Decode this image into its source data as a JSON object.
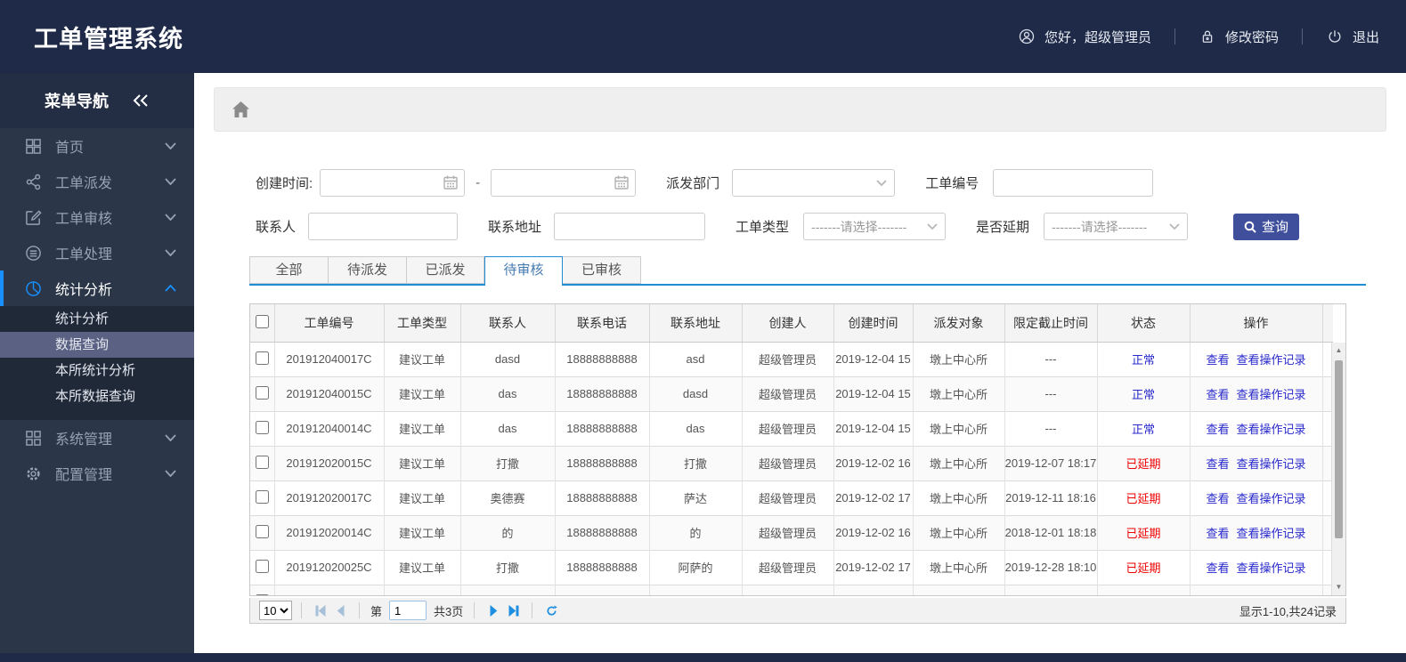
{
  "header": {
    "title": "工单管理系统",
    "greeting": "您好，超级管理员",
    "change_password": "修改密码",
    "logout": "退出"
  },
  "sidebar": {
    "title": "菜单导航",
    "items": [
      {
        "label": "首页",
        "icon": "grid-icon"
      },
      {
        "label": "工单派发",
        "icon": "share-icon"
      },
      {
        "label": "工单审核",
        "icon": "edit-icon"
      },
      {
        "label": "工单处理",
        "icon": "process-icon"
      },
      {
        "label": "统计分析",
        "icon": "pie-chart-icon",
        "expanded": true
      },
      {
        "label": "系统管理",
        "icon": "modules-icon"
      },
      {
        "label": "配置管理",
        "icon": "gear-icon"
      }
    ],
    "submenu": [
      {
        "label": "统计分析",
        "selected": false
      },
      {
        "label": "数据查询",
        "selected": true
      },
      {
        "label": "本所统计分析",
        "selected": false
      },
      {
        "label": "本所数据查询",
        "selected": false
      }
    ]
  },
  "filters": {
    "create_time_label": "创建时间:",
    "range_separator": "-",
    "dept_label": "派发部门",
    "order_no_label": "工单编号",
    "contact_label": "联系人",
    "address_label": "联系地址",
    "type_label": "工单类型",
    "delay_label": "是否延期",
    "select_placeholder": "-------请选择-------",
    "search_button": "查询"
  },
  "tabs": [
    {
      "label": "全部",
      "active": false
    },
    {
      "label": "待派发",
      "active": false
    },
    {
      "label": "已派发",
      "active": false
    },
    {
      "label": "待审核",
      "active": true
    },
    {
      "label": "已审核",
      "active": false
    }
  ],
  "table": {
    "columns": [
      "工单编号",
      "工单类型",
      "联系人",
      "联系电话",
      "联系地址",
      "创建人",
      "创建时间",
      "派发对象",
      "限定截止时间",
      "状态",
      "操作"
    ],
    "action_labels": [
      "查看",
      "查看操作记录"
    ],
    "rows": [
      {
        "order_no": "201912040017C",
        "type": "建议工单",
        "contact": "dasd",
        "phone": "18888888888",
        "address": "asd",
        "creator": "超级管理员",
        "created": "2019-12-04 15",
        "target": "墩上中心所",
        "deadline": "---",
        "status": "正常",
        "status_type": "normal"
      },
      {
        "order_no": "201912040015C",
        "type": "建议工单",
        "contact": "das",
        "phone": "18888888888",
        "address": "dasd",
        "creator": "超级管理员",
        "created": "2019-12-04 15",
        "target": "墩上中心所",
        "deadline": "---",
        "status": "正常",
        "status_type": "normal"
      },
      {
        "order_no": "201912040014C",
        "type": "建议工单",
        "contact": "das",
        "phone": "18888888888",
        "address": "das",
        "creator": "超级管理员",
        "created": "2019-12-04 15",
        "target": "墩上中心所",
        "deadline": "---",
        "status": "正常",
        "status_type": "normal"
      },
      {
        "order_no": "201912020015C",
        "type": "建议工单",
        "contact": "打撒",
        "phone": "18888888888",
        "address": "打撒",
        "creator": "超级管理员",
        "created": "2019-12-02 16",
        "target": "墩上中心所",
        "deadline": "2019-12-07 18:17",
        "status": "已延期",
        "status_type": "delayed"
      },
      {
        "order_no": "201912020017C",
        "type": "建议工单",
        "contact": "奥德赛",
        "phone": "18888888888",
        "address": "萨达",
        "creator": "超级管理员",
        "created": "2019-12-02 17",
        "target": "墩上中心所",
        "deadline": "2019-12-11 18:16",
        "status": "已延期",
        "status_type": "delayed"
      },
      {
        "order_no": "201912020014C",
        "type": "建议工单",
        "contact": "的",
        "phone": "18888888888",
        "address": "的",
        "creator": "超级管理员",
        "created": "2019-12-02 16",
        "target": "墩上中心所",
        "deadline": "2018-12-01 18:18",
        "status": "已延期",
        "status_type": "delayed"
      },
      {
        "order_no": "201912020025C",
        "type": "建议工单",
        "contact": "打撒",
        "phone": "18888888888",
        "address": "阿萨的",
        "creator": "超级管理员",
        "created": "2019-12-02 17",
        "target": "墩上中心所",
        "deadline": "2019-12-28 18:10",
        "status": "已延期",
        "status_type": "delayed"
      }
    ]
  },
  "pagination": {
    "page_size": "10",
    "page_prefix": "第",
    "page": "1",
    "total_pages": "共3页",
    "info": "显示1-10,共24记录"
  },
  "colors": {
    "header_bg": "#1e2a47",
    "sidebar_bg": "#2b3648",
    "accent_blue": "#1890ff",
    "selected_submenu_bg": "#5a6182",
    "search_button_bg": "#3f4f9c",
    "tab_border_blue": "#1f8dd6",
    "status_normal": "#2828cc",
    "status_delayed": "#ee0000",
    "link_blue": "#2828cc"
  }
}
